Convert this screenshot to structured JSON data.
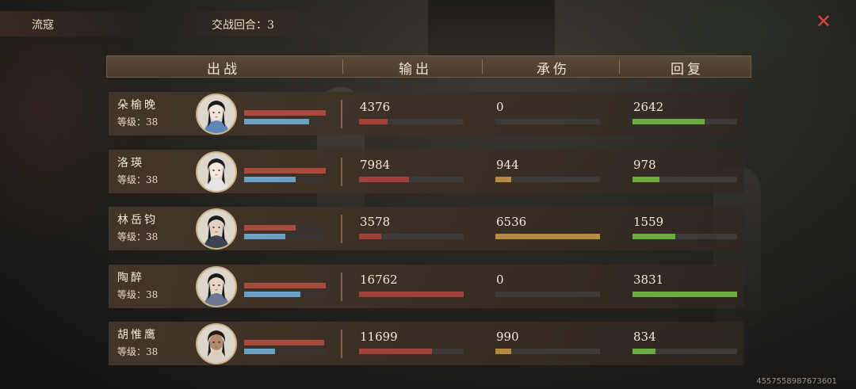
{
  "topbar": {
    "mode": "流寇",
    "round_label": "交战回合：3",
    "close_glyph": "✕"
  },
  "headers": {
    "battle": "出战",
    "output": "输出",
    "damage_taken": "承伤",
    "healing": "回复"
  },
  "rows": [
    {
      "name": "朵榆晚",
      "level": "等级：38",
      "hp_frac": 1.0,
      "mp_frac": 0.8,
      "output": "4376",
      "output_frac": 0.27,
      "taken": "0",
      "taken_frac": 0.0,
      "heal": "2642",
      "heal_frac": 0.69
    },
    {
      "name": "洛瑛",
      "level": "等级：38",
      "hp_frac": 1.0,
      "mp_frac": 0.63,
      "output": "7984",
      "output_frac": 0.48,
      "taken": "944",
      "taken_frac": 0.15,
      "heal": "978",
      "heal_frac": 0.26
    },
    {
      "name": "林岳钧",
      "level": "等级：38",
      "hp_frac": 0.63,
      "mp_frac": 0.5,
      "output": "3578",
      "output_frac": 0.21,
      "taken": "6536",
      "taken_frac": 1.0,
      "heal": "1559",
      "heal_frac": 0.41
    },
    {
      "name": "陶醉",
      "level": "等级：38",
      "hp_frac": 1.0,
      "mp_frac": 0.69,
      "output": "16762",
      "output_frac": 1.0,
      "taken": "0",
      "taken_frac": 0.0,
      "heal": "3831",
      "heal_frac": 1.0
    },
    {
      "name": "胡惟鹰",
      "level": "等级：38",
      "hp_frac": 0.98,
      "mp_frac": 0.38,
      "output": "11699",
      "output_frac": 0.7,
      "taken": "990",
      "taken_frac": 0.15,
      "heal": "834",
      "heal_frac": 0.22
    }
  ],
  "footer": {
    "id": "4557558987673601"
  },
  "colors": {
    "hp": "#a84a3e",
    "mp": "#6aa1c5",
    "output": "#a2403a",
    "taken": "#b78a42",
    "heal": "#6cab3f",
    "close": "#d7443a"
  },
  "icons": [
    "close-icon",
    "portrait-avatar"
  ]
}
